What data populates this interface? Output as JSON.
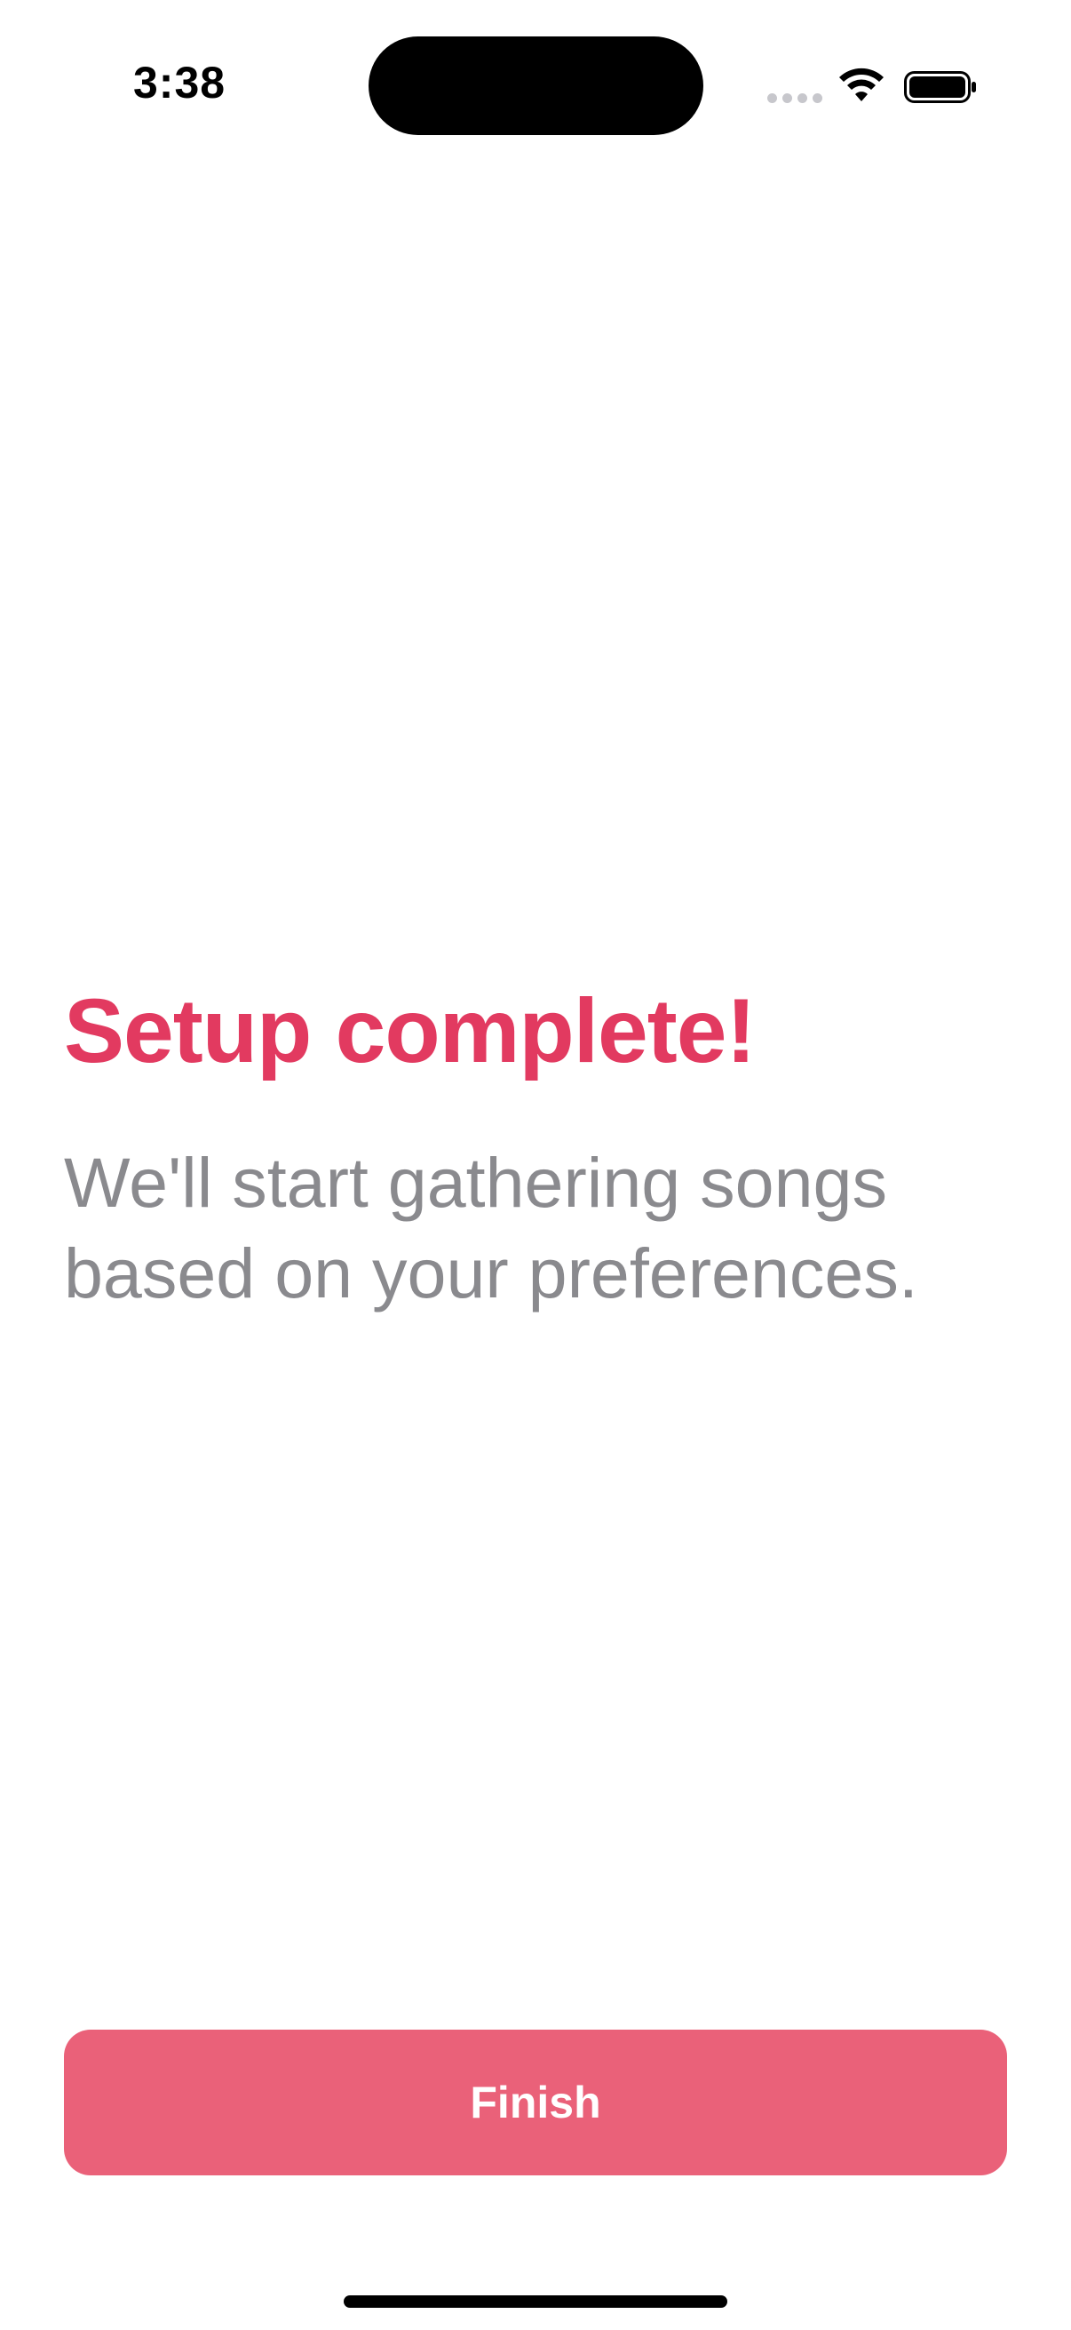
{
  "status_bar": {
    "time": "3:38",
    "signal_icon": "cellular-signal-icon",
    "wifi_icon": "wifi-icon",
    "battery_icon": "battery-icon"
  },
  "main": {
    "title": "Setup complete!",
    "subtitle": "We'll start gathering songs based on your preferences."
  },
  "footer": {
    "finish_label": "Finish"
  },
  "colors": {
    "accent": "#e23a60",
    "button": "#ea6179",
    "subtitle": "#8a8a8e"
  }
}
